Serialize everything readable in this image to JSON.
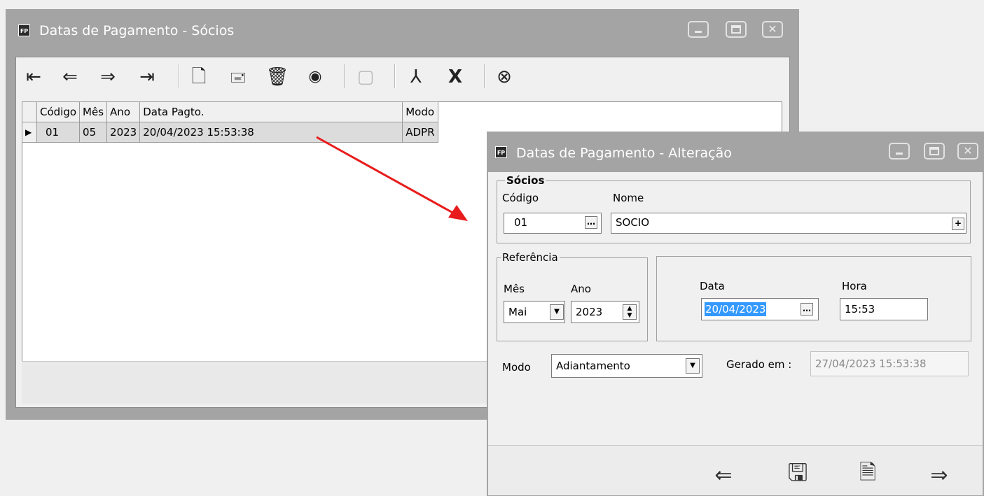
{
  "main_window": {
    "icon_text": "FP",
    "title": "Datas de Pagamento - Sócios",
    "toolbar_icons": [
      "first-record-icon",
      "previous-record-icon",
      "next-record-icon",
      "last-record-icon",
      "new-record-icon",
      "edit-record-icon",
      "delete-record-icon",
      "view-record-icon",
      "disabled-edit-icon",
      "pdf-export-icon",
      "excel-export-icon",
      "close-icon"
    ],
    "table": {
      "headers": [
        "Código",
        "Mês",
        "Ano",
        "Data Pagto.",
        "Modo"
      ],
      "rows": [
        [
          "01",
          "05",
          "2023",
          "20/04/2023 15:53:38",
          "ADPR"
        ]
      ]
    }
  },
  "dialog": {
    "icon_text": "FP",
    "title": "Datas de Pagamento - Alteração",
    "socios_group": "Sócios",
    "codigo_label": "Código",
    "codigo_value": "01",
    "nome_label": "Nome",
    "nome_value": "SOCIO",
    "referencia_group": "Referência",
    "mes_label": "Mês",
    "mes_value": "Mai",
    "ano_label": "Ano",
    "ano_value": "2023",
    "data_label": "Data",
    "data_value": "20/04/2023",
    "hora_label": "Hora",
    "hora_value": "15:53",
    "modo_label": "Modo",
    "modo_value": "Adiantamento",
    "gerado_label": "Gerado em :",
    "gerado_value": "27/04/2023 15:53:38"
  },
  "colors": {
    "titlebar": "#a4a4a4",
    "selection": "#3399ff",
    "arrow": "#e81c1c",
    "row_highlight": "#dcdcdc"
  }
}
